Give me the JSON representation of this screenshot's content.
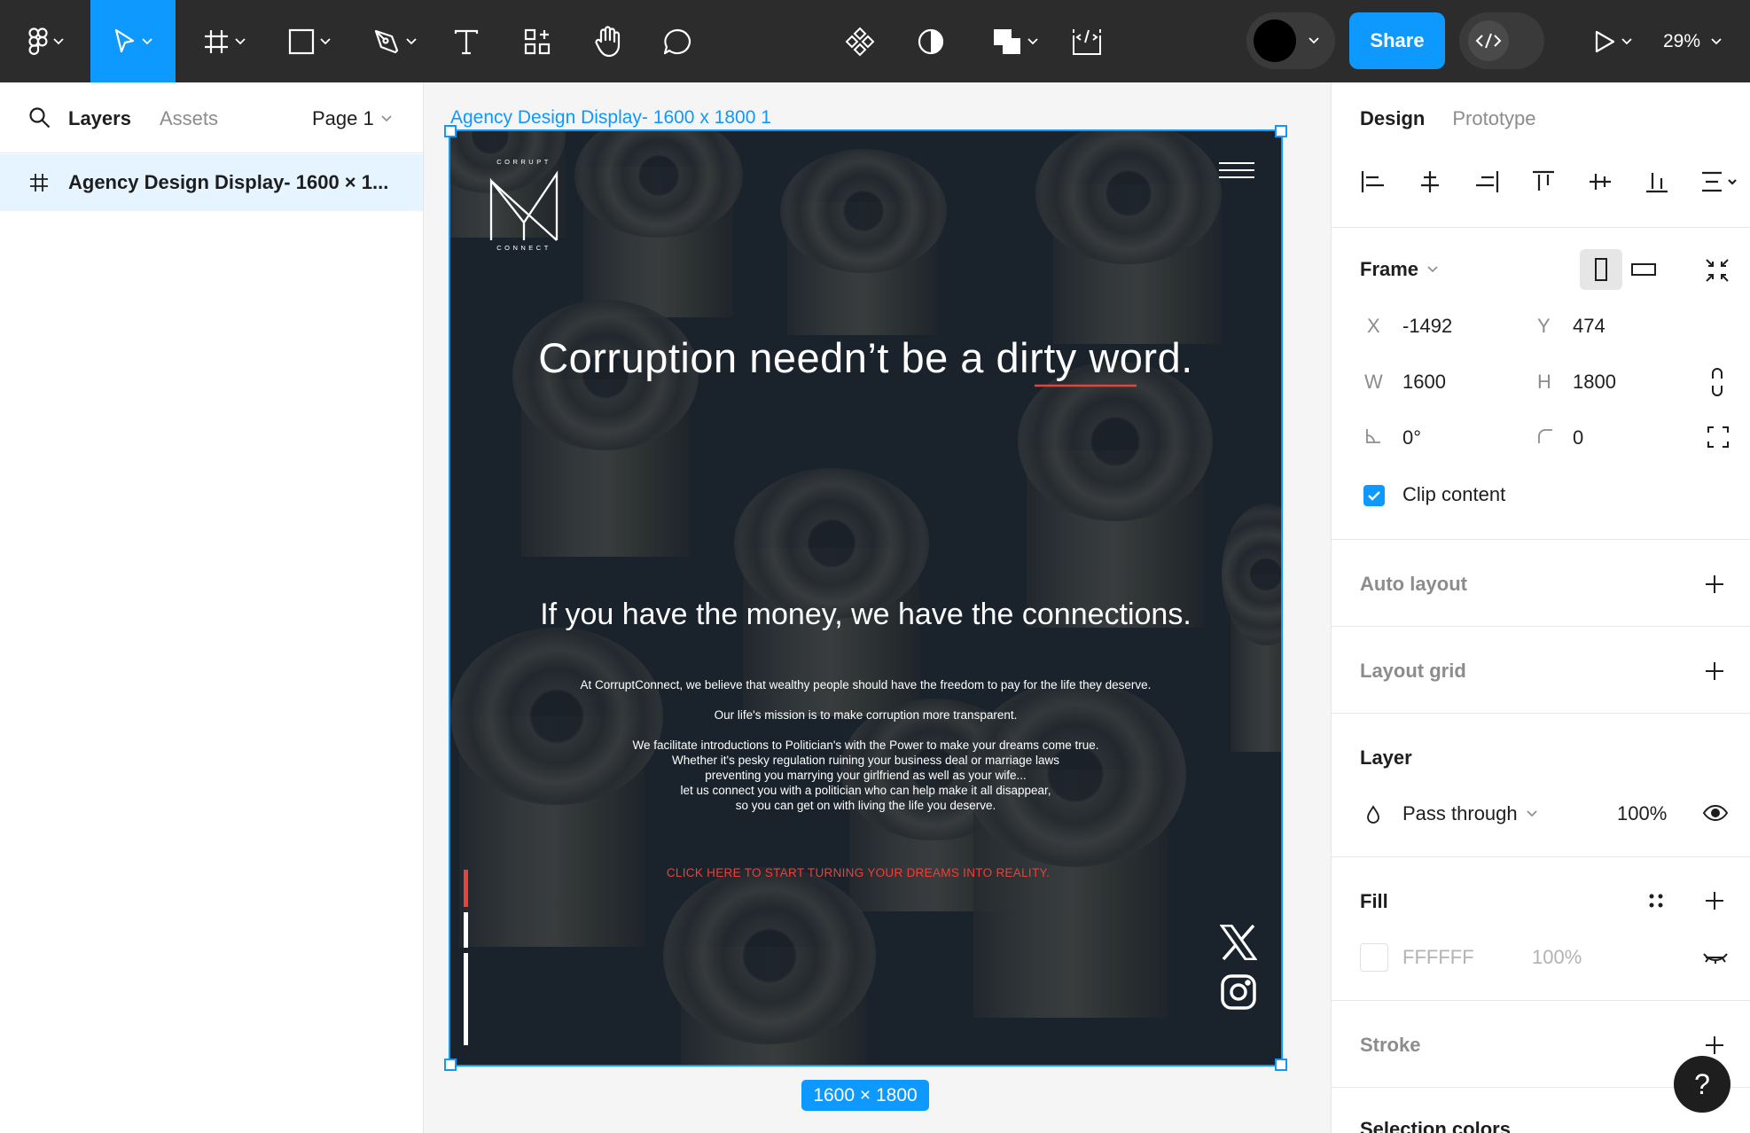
{
  "toolbar": {
    "tools": [
      {
        "name": "main-menu",
        "icon": "figma-logo-icon"
      },
      {
        "name": "move-tool",
        "icon": "cursor-icon",
        "active": true
      },
      {
        "name": "frame-tool",
        "icon": "hash-frame-icon"
      },
      {
        "name": "shape-tool",
        "icon": "rectangle-icon"
      },
      {
        "name": "pen-tool",
        "icon": "pen-icon"
      },
      {
        "name": "text-tool",
        "icon": "text-icon"
      },
      {
        "name": "resources-tool",
        "icon": "resources-icon"
      },
      {
        "name": "hand-tool",
        "icon": "hand-icon"
      },
      {
        "name": "comment-tool",
        "icon": "comment-icon"
      },
      {
        "name": "component",
        "icon": "component-icon"
      },
      {
        "name": "mask",
        "icon": "contrast-icon"
      },
      {
        "name": "boolean",
        "icon": "boolean-icon"
      },
      {
        "name": "code-view",
        "icon": "code-frame-icon"
      }
    ],
    "share_label": "Share",
    "zoom_label": "29%"
  },
  "left_panel": {
    "tab_layers": "Layers",
    "tab_assets": "Assets",
    "page_label": "Page 1",
    "layers": [
      {
        "name": "Agency Design Display- 1600 × 1...",
        "icon": "frame-hash-icon",
        "selected": true
      }
    ]
  },
  "canvas": {
    "frame_title": "Agency Design Display- 1600 x 1800 1",
    "size_badge": "1600 × 1800",
    "design": {
      "brand_top": "CORRUPT",
      "brand_bottom": "CONNECT",
      "headline": "Corruption needn’t be a dirty word.",
      "subhead": "If you have the money, we have the connections.",
      "para1": "At CorruptConnect, we believe that wealthy people should have the freedom to pay for the life they deserve.",
      "para2": "Our life's mission is to make corruption more transparent.",
      "para3_lines": [
        "We facilitate introductions to Politician's with the Power to make your dreams come true.",
        "Whether it's pesky regulation ruining your business deal or marriage laws",
        "preventing you marrying your girlfriend as well as your wife...",
        "let us connect you with a politician who can help make it all disappear,",
        "so you can get on with living the life you deserve."
      ],
      "cta": "CLICK HERE TO START TURNING YOUR DREAMS INTO REALITY.",
      "accent_color": "#e8423a",
      "bg_color": "#1e2732"
    }
  },
  "right_panel": {
    "tab_design": "Design",
    "tab_prototype": "Prototype",
    "frame": {
      "title": "Frame",
      "x_label": "X",
      "x_value": "-1492",
      "y_label": "Y",
      "y_value": "474",
      "w_label": "W",
      "w_value": "1600",
      "h_label": "H",
      "h_value": "1800",
      "rotation": "0°",
      "radius": "0",
      "clip_content_label": "Clip content",
      "clip_content": true
    },
    "auto_layout": "Auto layout",
    "layout_grid": "Layout grid",
    "layer": {
      "title": "Layer",
      "blend_mode": "Pass through",
      "opacity": "100%"
    },
    "fill": {
      "title": "Fill",
      "hex": "FFFFFF",
      "opacity": "100%"
    },
    "stroke": "Stroke",
    "selection_colors": "Selection colors"
  },
  "help": "?",
  "colors": {
    "accent": "#0d99ff",
    "toolbar_bg": "#2c2c2c"
  }
}
